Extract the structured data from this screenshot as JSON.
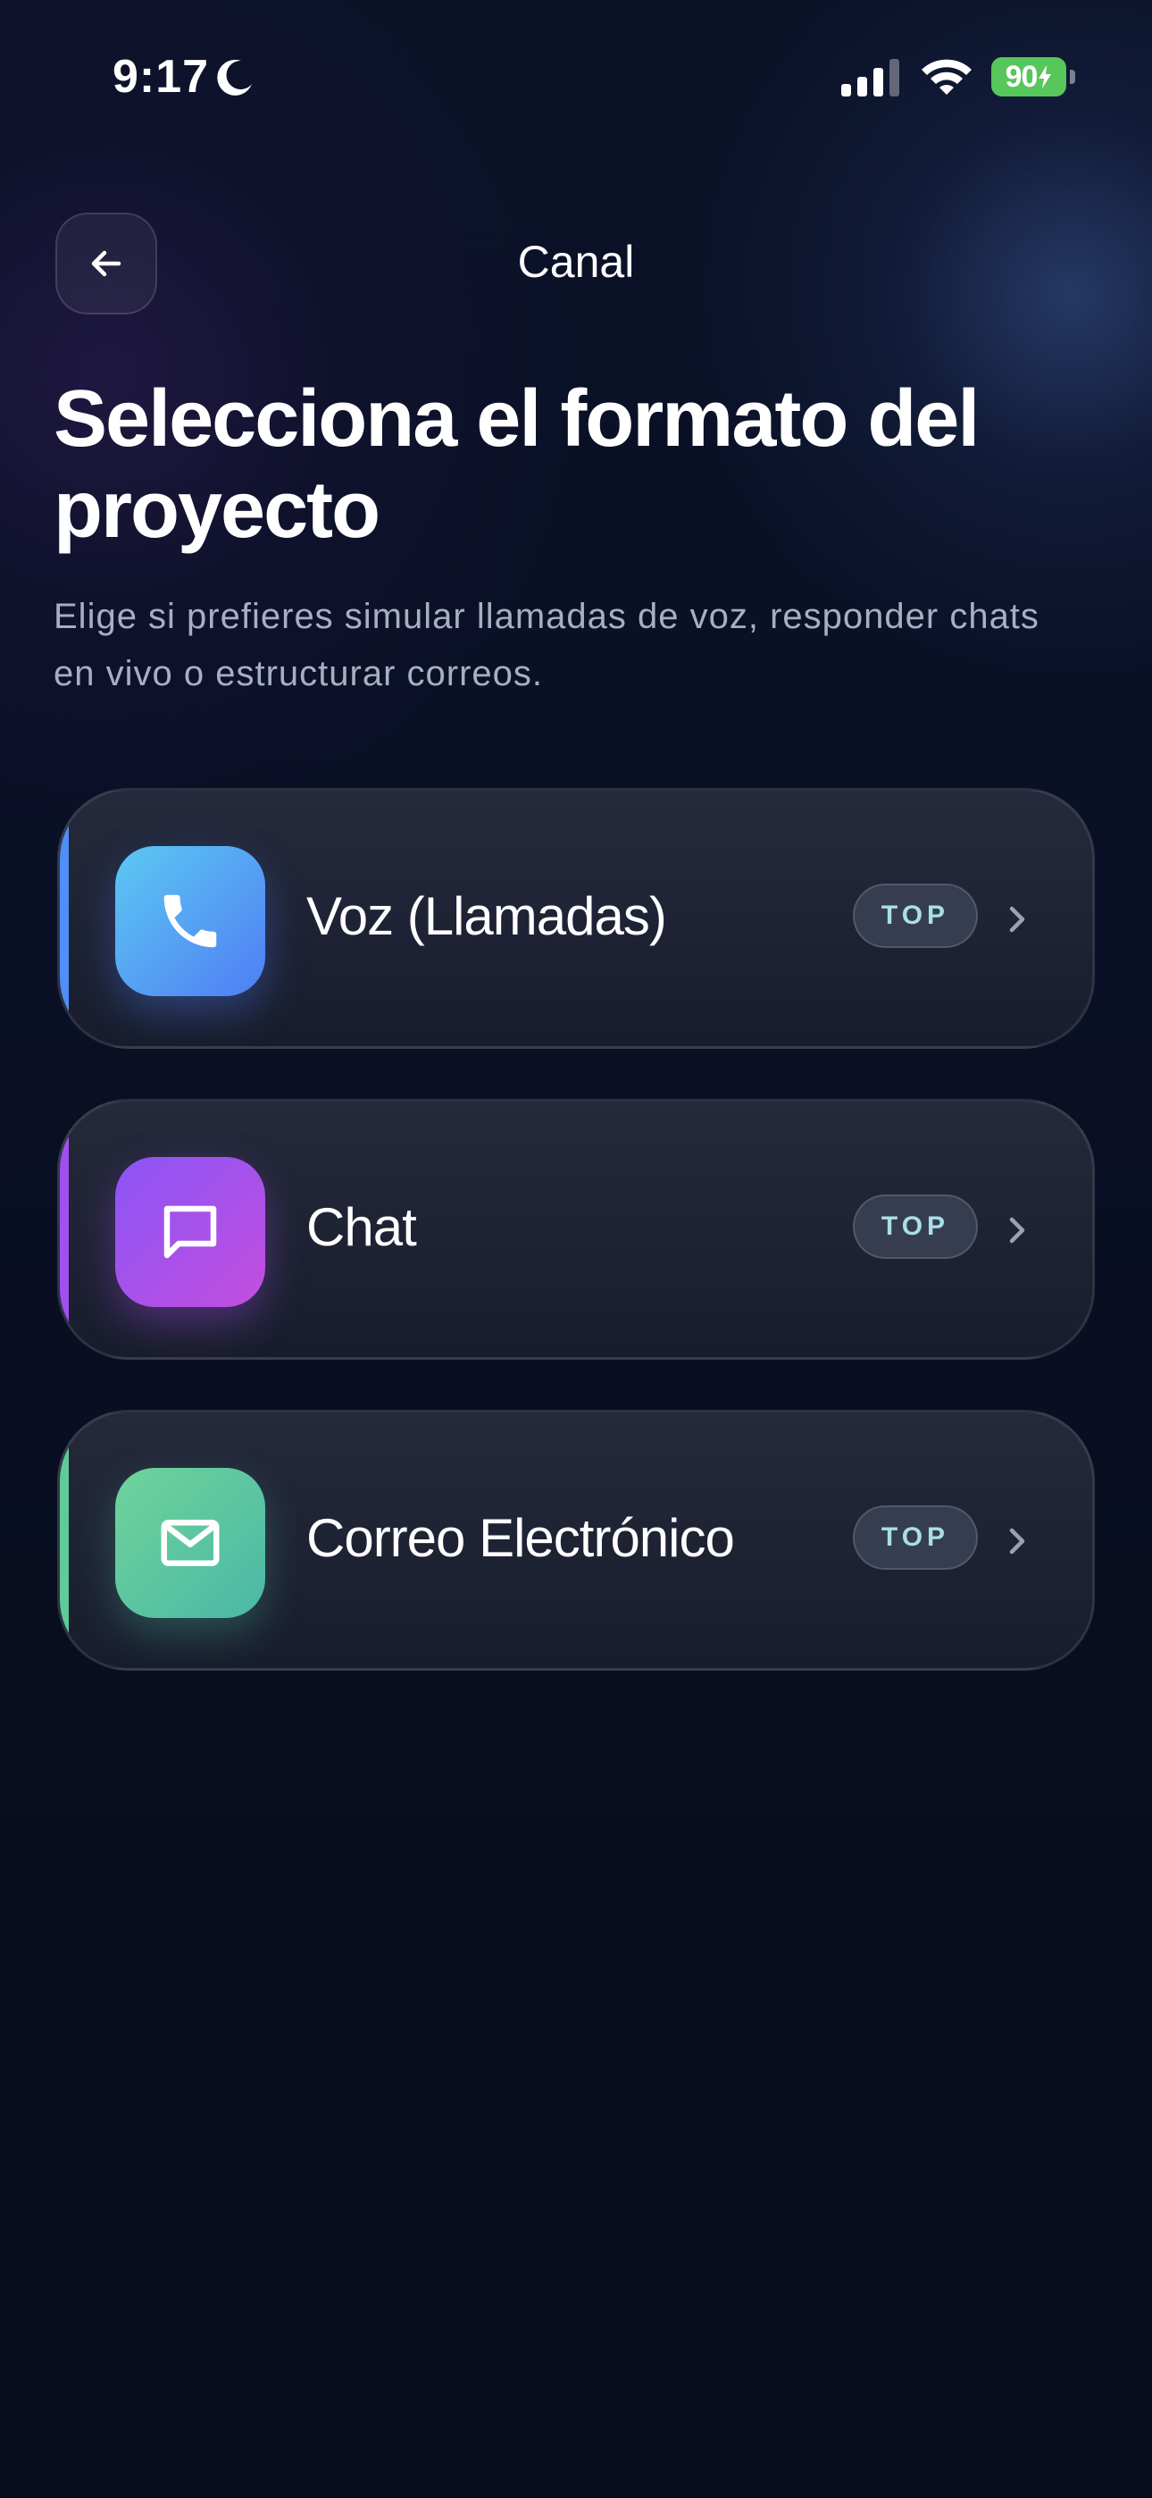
{
  "status_bar": {
    "time": "9:17",
    "battery_level": "90",
    "battery_color": "#57c65b",
    "icons": [
      "moon-icon",
      "signal-icon",
      "wifi-icon",
      "battery-charging-icon"
    ]
  },
  "header": {
    "title": "Canal",
    "back_icon": "arrow-left-icon"
  },
  "main": {
    "title": "Selecciona el formato del proyecto",
    "subtitle": "Elige si prefieres simular llamadas de voz, responder chats en vivo o estructurar correos."
  },
  "options": [
    {
      "label": "Voz (Llamadas)",
      "badge": "TOP",
      "icon": "phone-icon",
      "accent": "#4f8ff7",
      "gradient_from": "#5cc8f2",
      "gradient_to": "#4f7ef4"
    },
    {
      "label": "Chat",
      "badge": "TOP",
      "icon": "chat-bubble-icon",
      "accent": "#a24ff0",
      "gradient_from": "#8b55f5",
      "gradient_to": "#c34ee0"
    },
    {
      "label": "Correo Electrónico",
      "badge": "TOP",
      "icon": "mail-icon",
      "accent": "#5ecb98",
      "gradient_from": "#6fd39a",
      "gradient_to": "#4bb8a6"
    }
  ]
}
